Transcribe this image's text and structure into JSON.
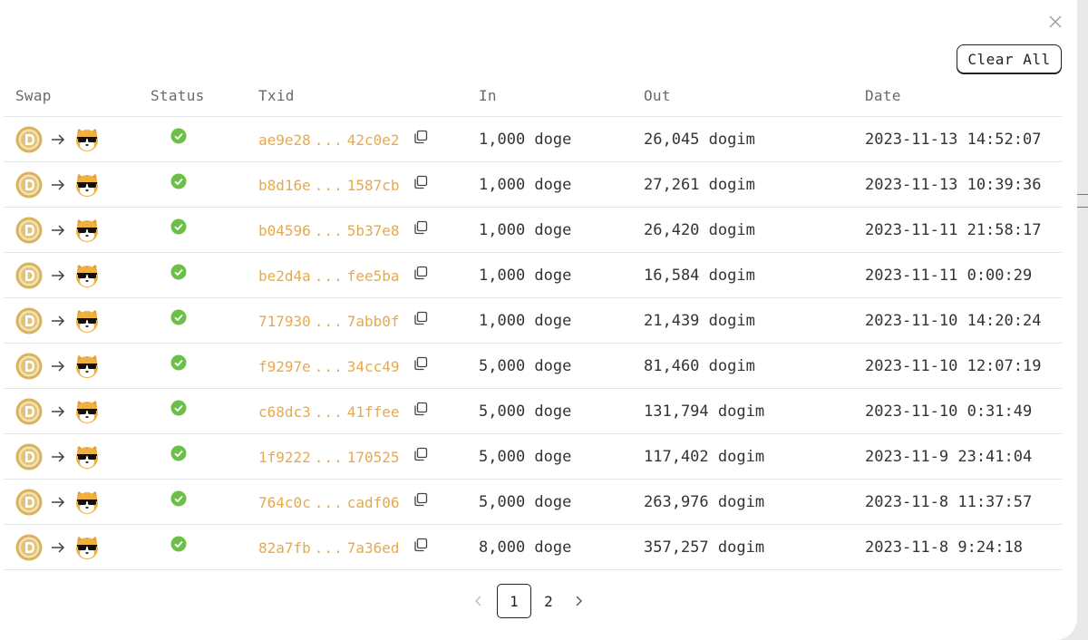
{
  "actions": {
    "clear_all_label": "Clear All"
  },
  "columns": {
    "swap": "Swap",
    "status": "Status",
    "txid": "Txid",
    "in": "In",
    "out": "Out",
    "date": "Date"
  },
  "colors": {
    "txid": "#e8a94a",
    "success": "#6cc04a",
    "doge_coin": "#d8b25a"
  },
  "icons": {
    "from_token": "doge-coin-icon",
    "to_token": "dogim-sunglasses-icon",
    "status": "success-check-icon",
    "copy": "copy-icon",
    "close": "close-icon"
  },
  "rows": [
    {
      "tx_start": "ae9e28",
      "tx_end": "42c0e2",
      "in": "1,000 doge",
      "out": "26,045 dogim",
      "date": "2023-11-13 14:52:07"
    },
    {
      "tx_start": "b8d16e",
      "tx_end": "1587cb",
      "in": "1,000 doge",
      "out": "27,261 dogim",
      "date": "2023-11-13 10:39:36"
    },
    {
      "tx_start": "b04596",
      "tx_end": "5b37e8",
      "in": "1,000 doge",
      "out": "26,420 dogim",
      "date": "2023-11-11 21:58:17"
    },
    {
      "tx_start": "be2d4a",
      "tx_end": "fee5ba",
      "in": "1,000 doge",
      "out": "16,584 dogim",
      "date": "2023-11-11 0:00:29"
    },
    {
      "tx_start": "717930",
      "tx_end": "7abb0f",
      "in": "1,000 doge",
      "out": "21,439 dogim",
      "date": "2023-11-10 14:20:24"
    },
    {
      "tx_start": "f9297e",
      "tx_end": "34cc49",
      "in": "5,000 doge",
      "out": "81,460 dogim",
      "date": "2023-11-10 12:07:19"
    },
    {
      "tx_start": "c68dc3",
      "tx_end": "41ffee",
      "in": "5,000 doge",
      "out": "131,794 dogim",
      "date": "2023-11-10 0:31:49"
    },
    {
      "tx_start": "1f9222",
      "tx_end": "170525",
      "in": "5,000 doge",
      "out": "117,402 dogim",
      "date": "2023-11-9 23:41:04"
    },
    {
      "tx_start": "764c0c",
      "tx_end": "cadf06",
      "in": "5,000 doge",
      "out": "263,976 dogim",
      "date": "2023-11-8 11:37:57"
    },
    {
      "tx_start": "82a7fb",
      "tx_end": "7a36ed",
      "in": "8,000 doge",
      "out": "357,257 dogim",
      "date": "2023-11-8 9:24:18"
    }
  ],
  "pagination": {
    "ellipsis": "...",
    "pages": [
      "1",
      "2"
    ],
    "current": "1"
  }
}
